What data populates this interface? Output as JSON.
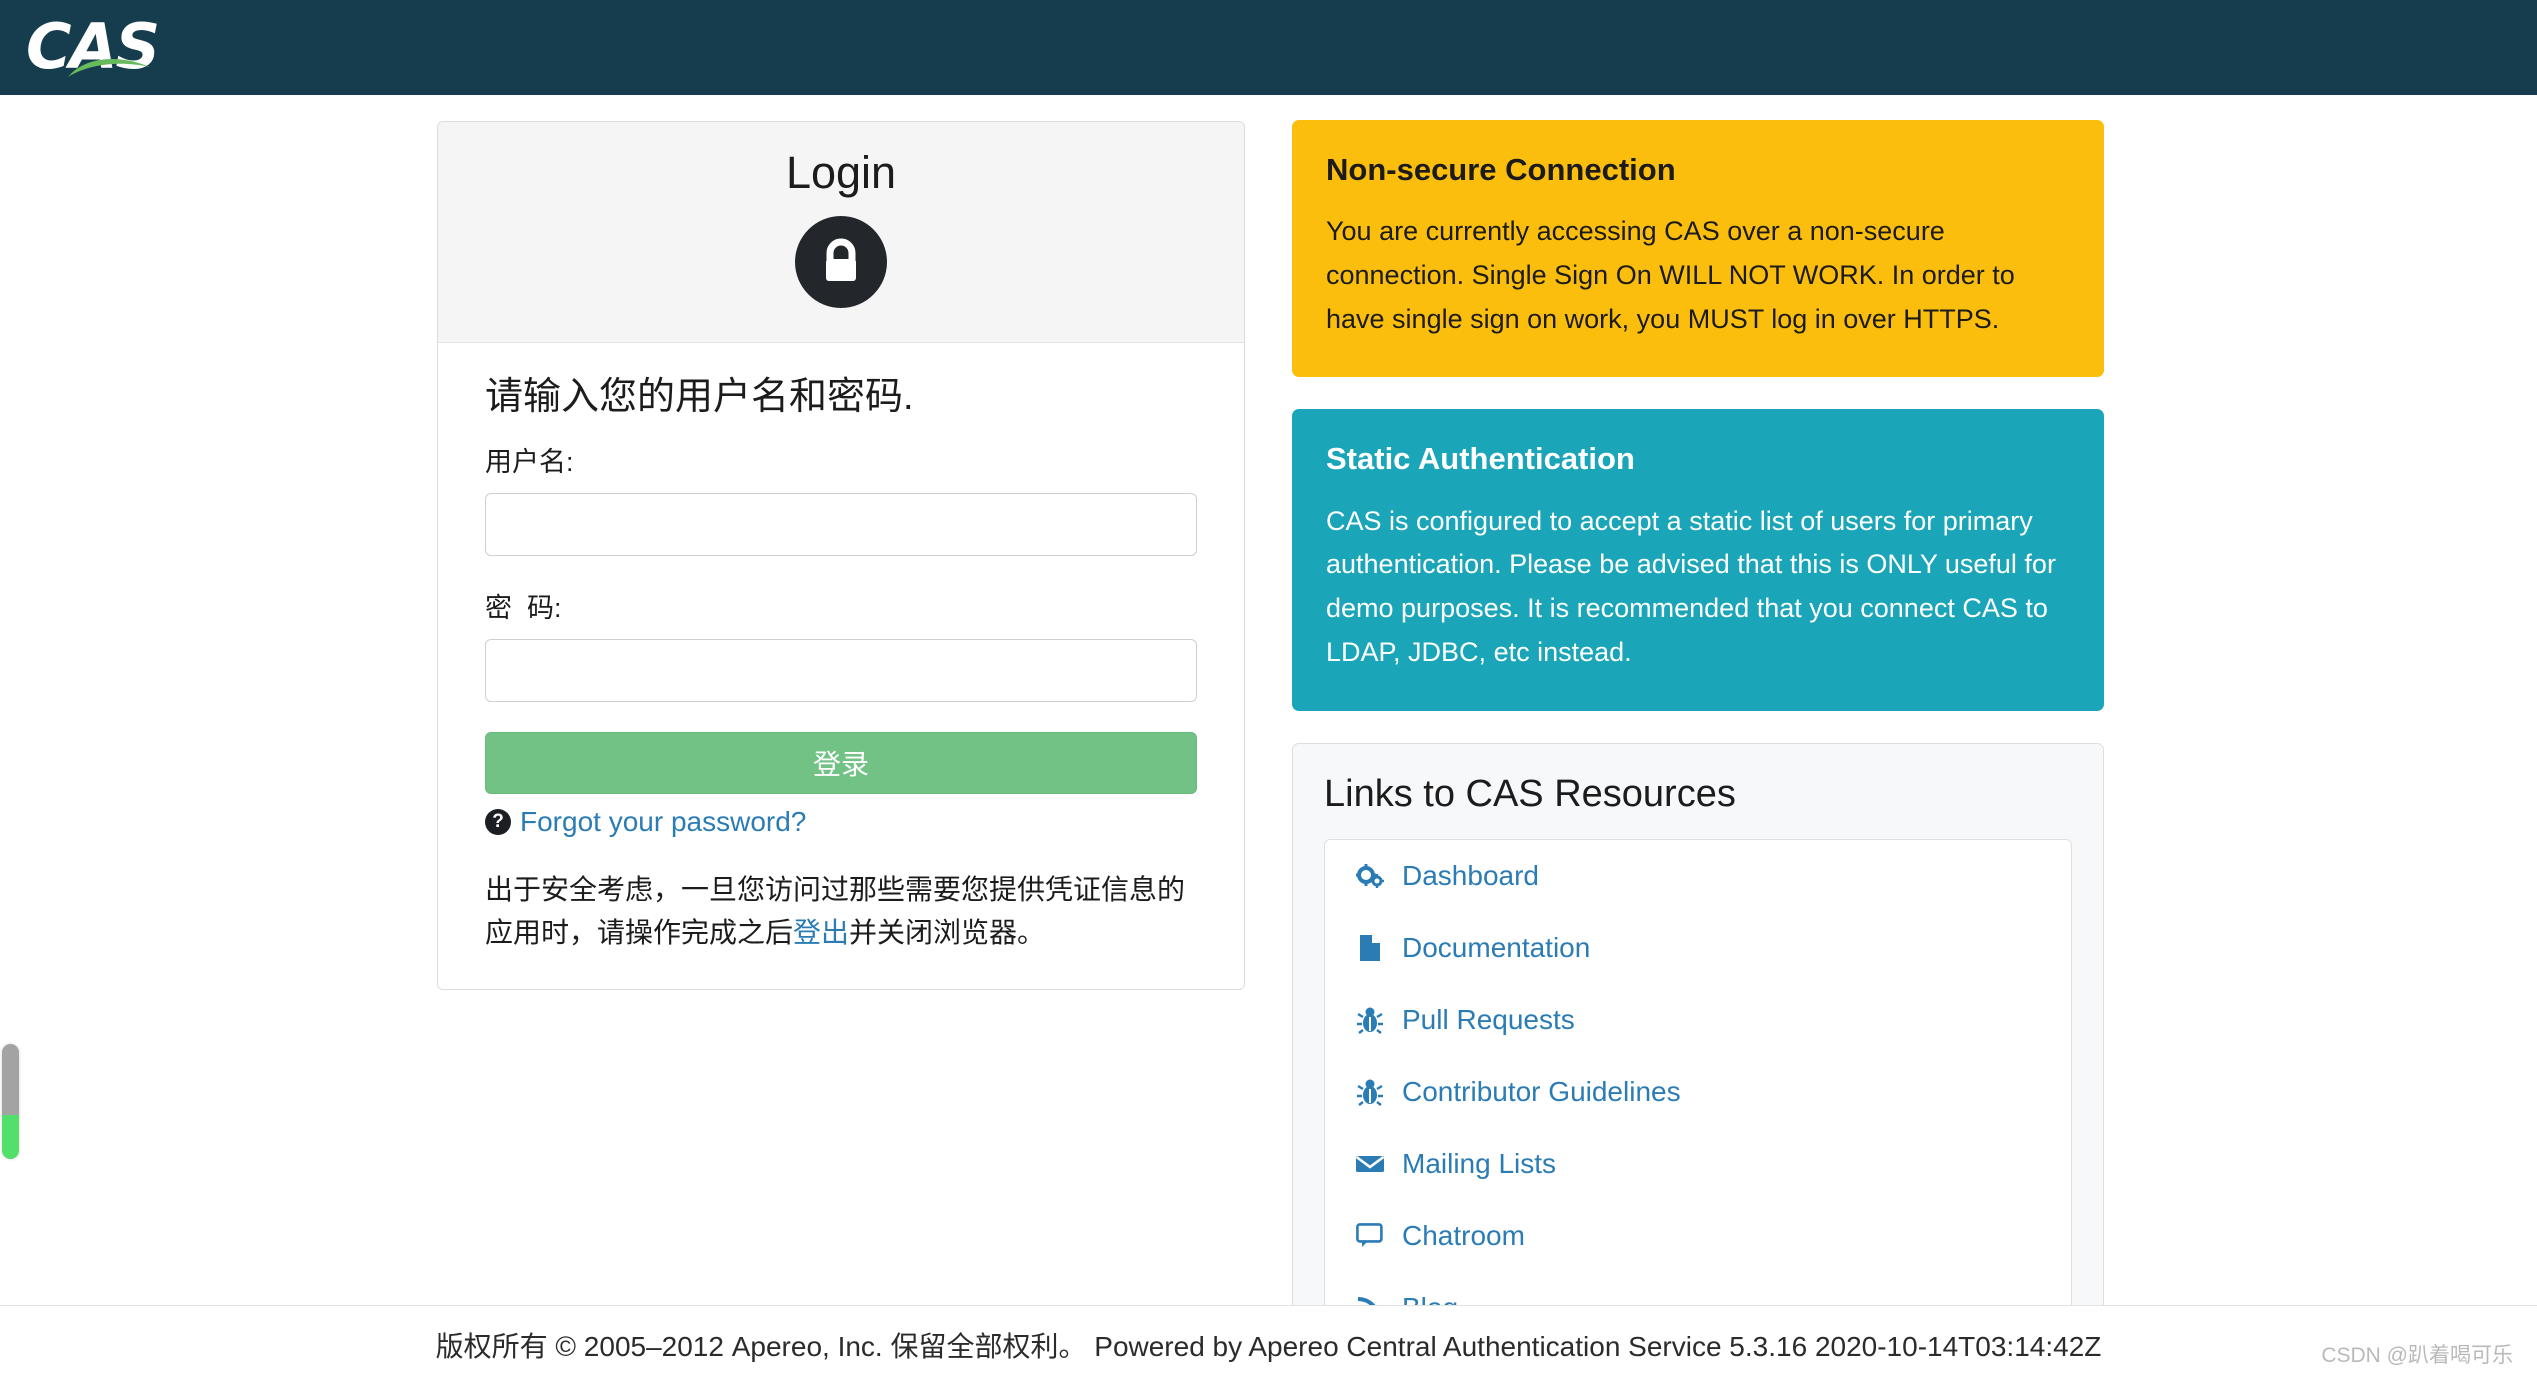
{
  "header": {
    "logo_text": "CAS",
    "logo_icon": "cas-logo-swoosh",
    "background_color": "#163d4e"
  },
  "login_card": {
    "title": "Login",
    "lock_icon": "lock-icon",
    "prompt": "请输入您的用户名和密码.",
    "username": {
      "label": "用户名:",
      "value": "",
      "placeholder": ""
    },
    "password": {
      "label": "密  码:",
      "value": "",
      "placeholder": ""
    },
    "submit_label": "登录",
    "submit_color": "#72c286",
    "forgot_icon": "question-circle-icon",
    "forgot_label": "Forgot your password?",
    "notice_prefix": "出于安全考虑，一旦您访问过那些需要您提供凭证信息的应用时，请操作完成之后",
    "notice_link": "登出",
    "notice_suffix": "并关闭浏览器。"
  },
  "panels": [
    {
      "id": "non-secure-connection",
      "title": "Non-secure Connection",
      "body": "You are currently accessing CAS over a non-secure connection. Single Sign On WILL NOT WORK. In order to have single sign on work, you MUST log in over HTTPS.",
      "color": "#fcbe0c"
    },
    {
      "id": "static-authentication",
      "title": "Static Authentication",
      "body": "CAS is configured to accept a static list of users for primary authentication. Please be advised that this is ONLY useful for demo purposes. It is recommended that you connect CAS to LDAP, JDBC, etc instead.",
      "color": "#1aa5b8"
    }
  ],
  "resources": {
    "title": "Links to CAS Resources",
    "link_color": "#2b7cb5",
    "items": [
      {
        "label": "Dashboard",
        "icon": "cogs-icon"
      },
      {
        "label": "Documentation",
        "icon": "file-icon"
      },
      {
        "label": "Pull Requests",
        "icon": "bug-icon"
      },
      {
        "label": "Contributor Guidelines",
        "icon": "bug-icon"
      },
      {
        "label": "Mailing Lists",
        "icon": "envelope-icon"
      },
      {
        "label": "Chatroom",
        "icon": "comment-icon"
      },
      {
        "label": "Blog",
        "icon": "rss-icon"
      }
    ]
  },
  "footer": {
    "text": "版权所有 © 2005–2012 Apereo, Inc. 保留全部权利。 Powered by Apereo Central Authentication Service 5.3.16 2020-10-14T03:14:42Z",
    "watermark": "CSDN @趴着喝可乐"
  },
  "scroll_indicator": {
    "track_color": "#a3a3a3",
    "fill_color": "#53e06a"
  }
}
